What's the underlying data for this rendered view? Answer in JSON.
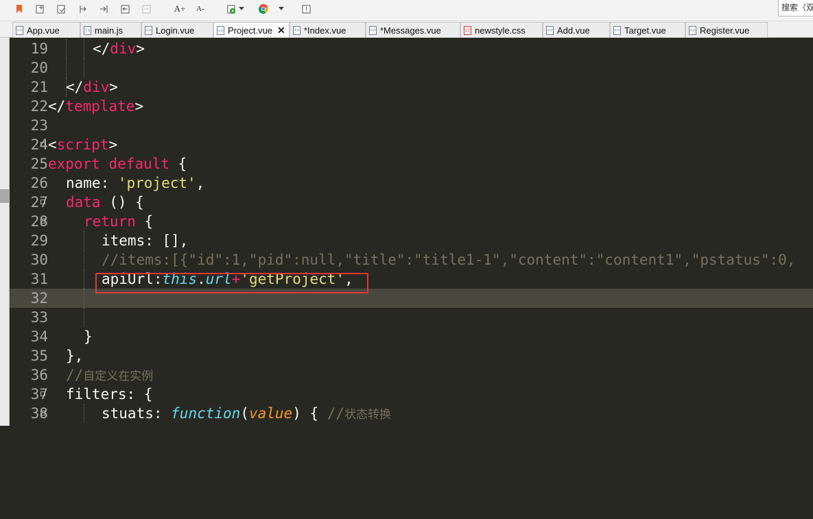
{
  "toolbar": {
    "icons": [
      "bookmark-icon",
      "new-file-icon",
      "save-icon",
      "indent-icon",
      "outdent-icon",
      "comment-icon",
      "uncomment-icon",
      "font-increase-icon",
      "font-decrease-icon",
      "run-icon",
      "browser-icon",
      "dropdown-arrow-icon",
      "info-icon"
    ],
    "font_increase_glyph": "A+",
    "font_decrease_glyph": "A-",
    "search_label": "搜索（双"
  },
  "tabs": [
    {
      "label": "App.vue",
      "active": false
    },
    {
      "label": "main.js",
      "active": false
    },
    {
      "label": "Login.vue",
      "active": false
    },
    {
      "label": "Project.vue",
      "active": true
    },
    {
      "label": "*Index.vue",
      "active": false
    },
    {
      "label": "*Messages.vue",
      "active": false
    },
    {
      "label": "newstyle.css",
      "active": false
    },
    {
      "label": "Add.vue",
      "active": false
    },
    {
      "label": "Target.vue",
      "active": false
    },
    {
      "label": "Register.vue",
      "active": false
    }
  ],
  "editor": {
    "current_line": 32,
    "highlighted_line": 31,
    "line_numbers": [
      "19",
      "20",
      "21",
      "22",
      "23",
      "24",
      "25",
      "26",
      "27",
      "28",
      "29",
      "30",
      "31",
      "32",
      "33",
      "34",
      "35",
      "36",
      "37",
      "38"
    ],
    "code": {
      "l19_a": "</",
      "l19_b": "div",
      "l19_c": ">",
      "l21_a": "</",
      "l21_b": "div",
      "l21_c": ">",
      "l22_a": "</",
      "l22_b": "template",
      "l22_c": ">",
      "l24_a": "<",
      "l24_b": "script",
      "l24_c": ">",
      "l25_kw1": "export",
      "l25_kw2": "default",
      "l25_rest": " {",
      "l26_a": "name: ",
      "l26_str": "'project'",
      "l26_c": ",",
      "l27_kw": "data",
      "l27_rest": " () {",
      "l28_kw": "return",
      "l28_rest": " {",
      "l29": "items: [],",
      "l30": "//items:[{\"id\":1,\"pid\":null,\"title\":\"title1-1\",\"content\":\"content1\",\"pstatus\":0,",
      "l31_a": "apiUrl:",
      "l31_this": "this",
      "l31_dot": ".",
      "l31_url": "url",
      "l31_plus": "+",
      "l31_str": "'getProject'",
      "l31_c": ",",
      "l34": "}",
      "l35": "},",
      "l36_slash": "//",
      "l36_cjk": "自定义在实例",
      "l37": "filters: {",
      "l38_a": "stuats: ",
      "l38_fn": "function",
      "l38_b": "(",
      "l38_param": "value",
      "l38_c": ") { ",
      "l38_cmt": "//",
      "l38_cjk": "状态转换"
    }
  },
  "colors": {
    "editor_bg": "#272822",
    "keyword": "#f92672",
    "string": "#e6db74",
    "comment": "#75715e",
    "builtin": "#66d9ef",
    "param": "#fd971f",
    "highlight_box": "#e23a3a"
  }
}
